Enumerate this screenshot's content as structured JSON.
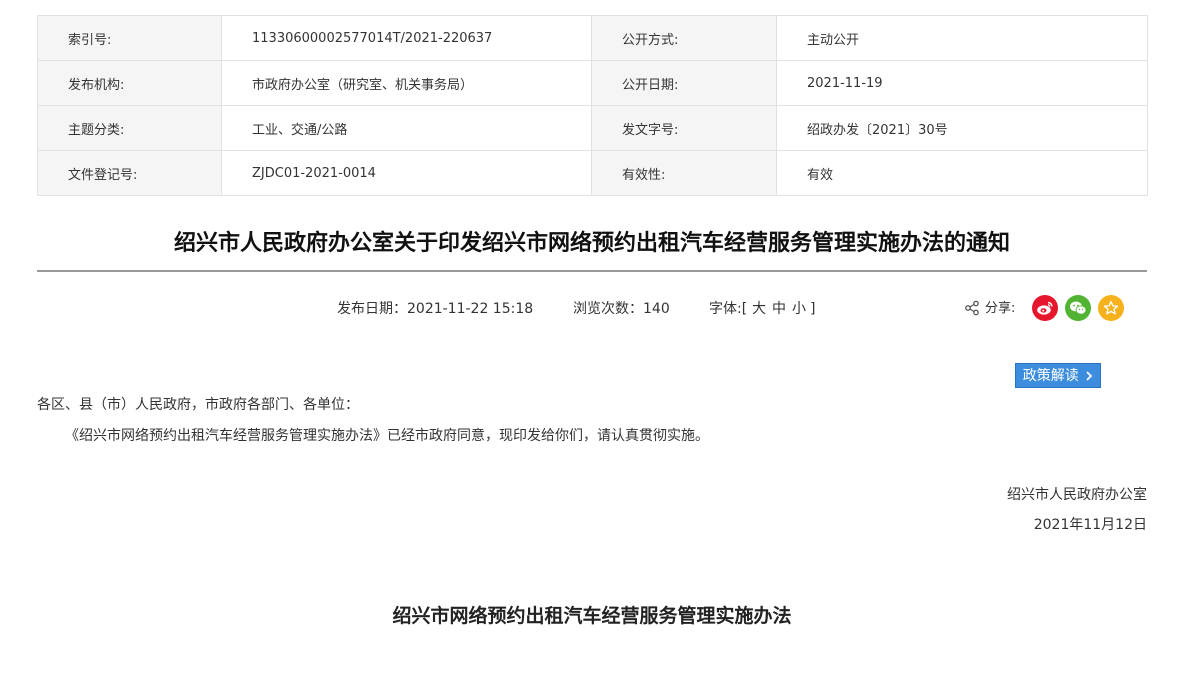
{
  "meta": {
    "rows": [
      {
        "label1": "索引号:",
        "value1": "11330600002577014T/2021-220637",
        "label2": "公开方式:",
        "value2": "主动公开"
      },
      {
        "label1": "发布机构:",
        "value1": "市政府办公室（研究室、机关事务局）",
        "label2": "公开日期:",
        "value2": "2021-11-19"
      },
      {
        "label1": "主题分类:",
        "value1": "工业、交通/公路",
        "label2": "发文字号:",
        "value2": "绍政办发〔2021〕30号"
      },
      {
        "label1": "文件登记号:",
        "value1": "ZJDC01-2021-0014",
        "label2": "有效性:",
        "value2": "有效"
      }
    ]
  },
  "article": {
    "title": "绍兴市人民政府办公室关于印发绍兴市网络预约出租汽车经营服务管理实施办法的通知",
    "publish_date": "发布日期：2021-11-22 15:18",
    "views": "浏览次数：140",
    "font_size_label": "字体:[",
    "font_large": "大",
    "font_medium": "中",
    "font_small": "小",
    "font_close": "]",
    "share_label": "分享:",
    "policy_button": "政策解读",
    "salutation": "各区、县（市）人民政府，市政府各部门、各单位：",
    "body": "《绍兴市网络预约出租汽车经营服务管理实施办法》已经市政府同意，现印发给你们，请认真贯彻实施。",
    "issuer": "绍兴市人民政府办公室",
    "date": "2021年11月12日",
    "attachment_title": "绍兴市网络预约出租汽车经营服务管理实施办法"
  },
  "colors": {
    "weibo": "#e6162d",
    "wechat": "#50b332",
    "favorite": "#f6b21d",
    "policy": "#3d8ddf"
  },
  "icons": {
    "share": "share-icon",
    "weibo": "weibo-icon",
    "wechat": "wechat-icon",
    "favorite": "star-icon",
    "arrow": "chevron-right-icon"
  }
}
